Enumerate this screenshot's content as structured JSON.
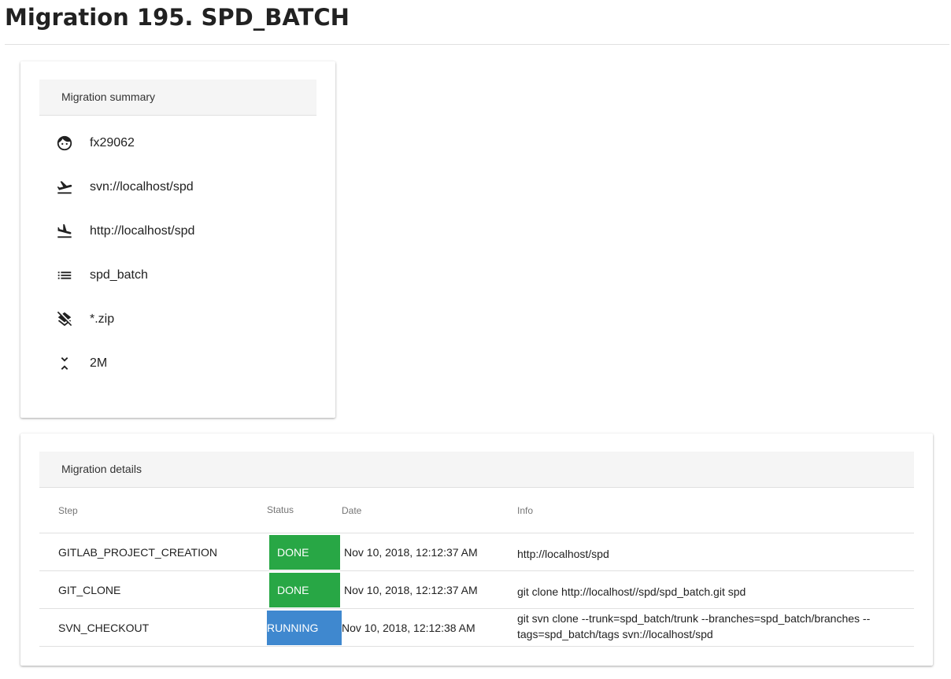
{
  "page": {
    "title": "Migration 195. SPD_BATCH"
  },
  "summary": {
    "header": "Migration summary",
    "items": [
      {
        "icon": "face-icon",
        "value": "fx29062"
      },
      {
        "icon": "flight-takeoff-icon",
        "value": "svn://localhost/spd"
      },
      {
        "icon": "flight-land-icon",
        "value": "http://localhost/spd"
      },
      {
        "icon": "list-icon",
        "value": "spd_batch"
      },
      {
        "icon": "layers-clear-icon",
        "value": "*.zip"
      },
      {
        "icon": "compress-icon",
        "value": "2M"
      }
    ]
  },
  "details": {
    "header": "Migration details",
    "columns": {
      "step": "Step",
      "status": "Status",
      "date": "Date",
      "info": "Info"
    },
    "rows": [
      {
        "step": "GITLAB_PROJECT_CREATION",
        "status": "DONE",
        "date": "Nov 10, 2018, 12:12:37 AM",
        "info": "http://localhost/spd"
      },
      {
        "step": "GIT_CLONE",
        "status": "DONE",
        "date": "Nov 10, 2018, 12:12:37 AM",
        "info": "git clone http://localhost//spd/spd_batch.git spd"
      },
      {
        "step": "SVN_CHECKOUT",
        "status": "RUNNING",
        "date": "Nov 10, 2018, 12:12:38 AM",
        "info": "git svn clone --trunk=spd_batch/trunk --branches=spd_batch/branches --tags=spd_batch/tags svn://localhost/spd"
      }
    ]
  },
  "colors": {
    "done": "#28a745",
    "running": "#3f88cf",
    "header_bg": "#f5f5f5"
  }
}
